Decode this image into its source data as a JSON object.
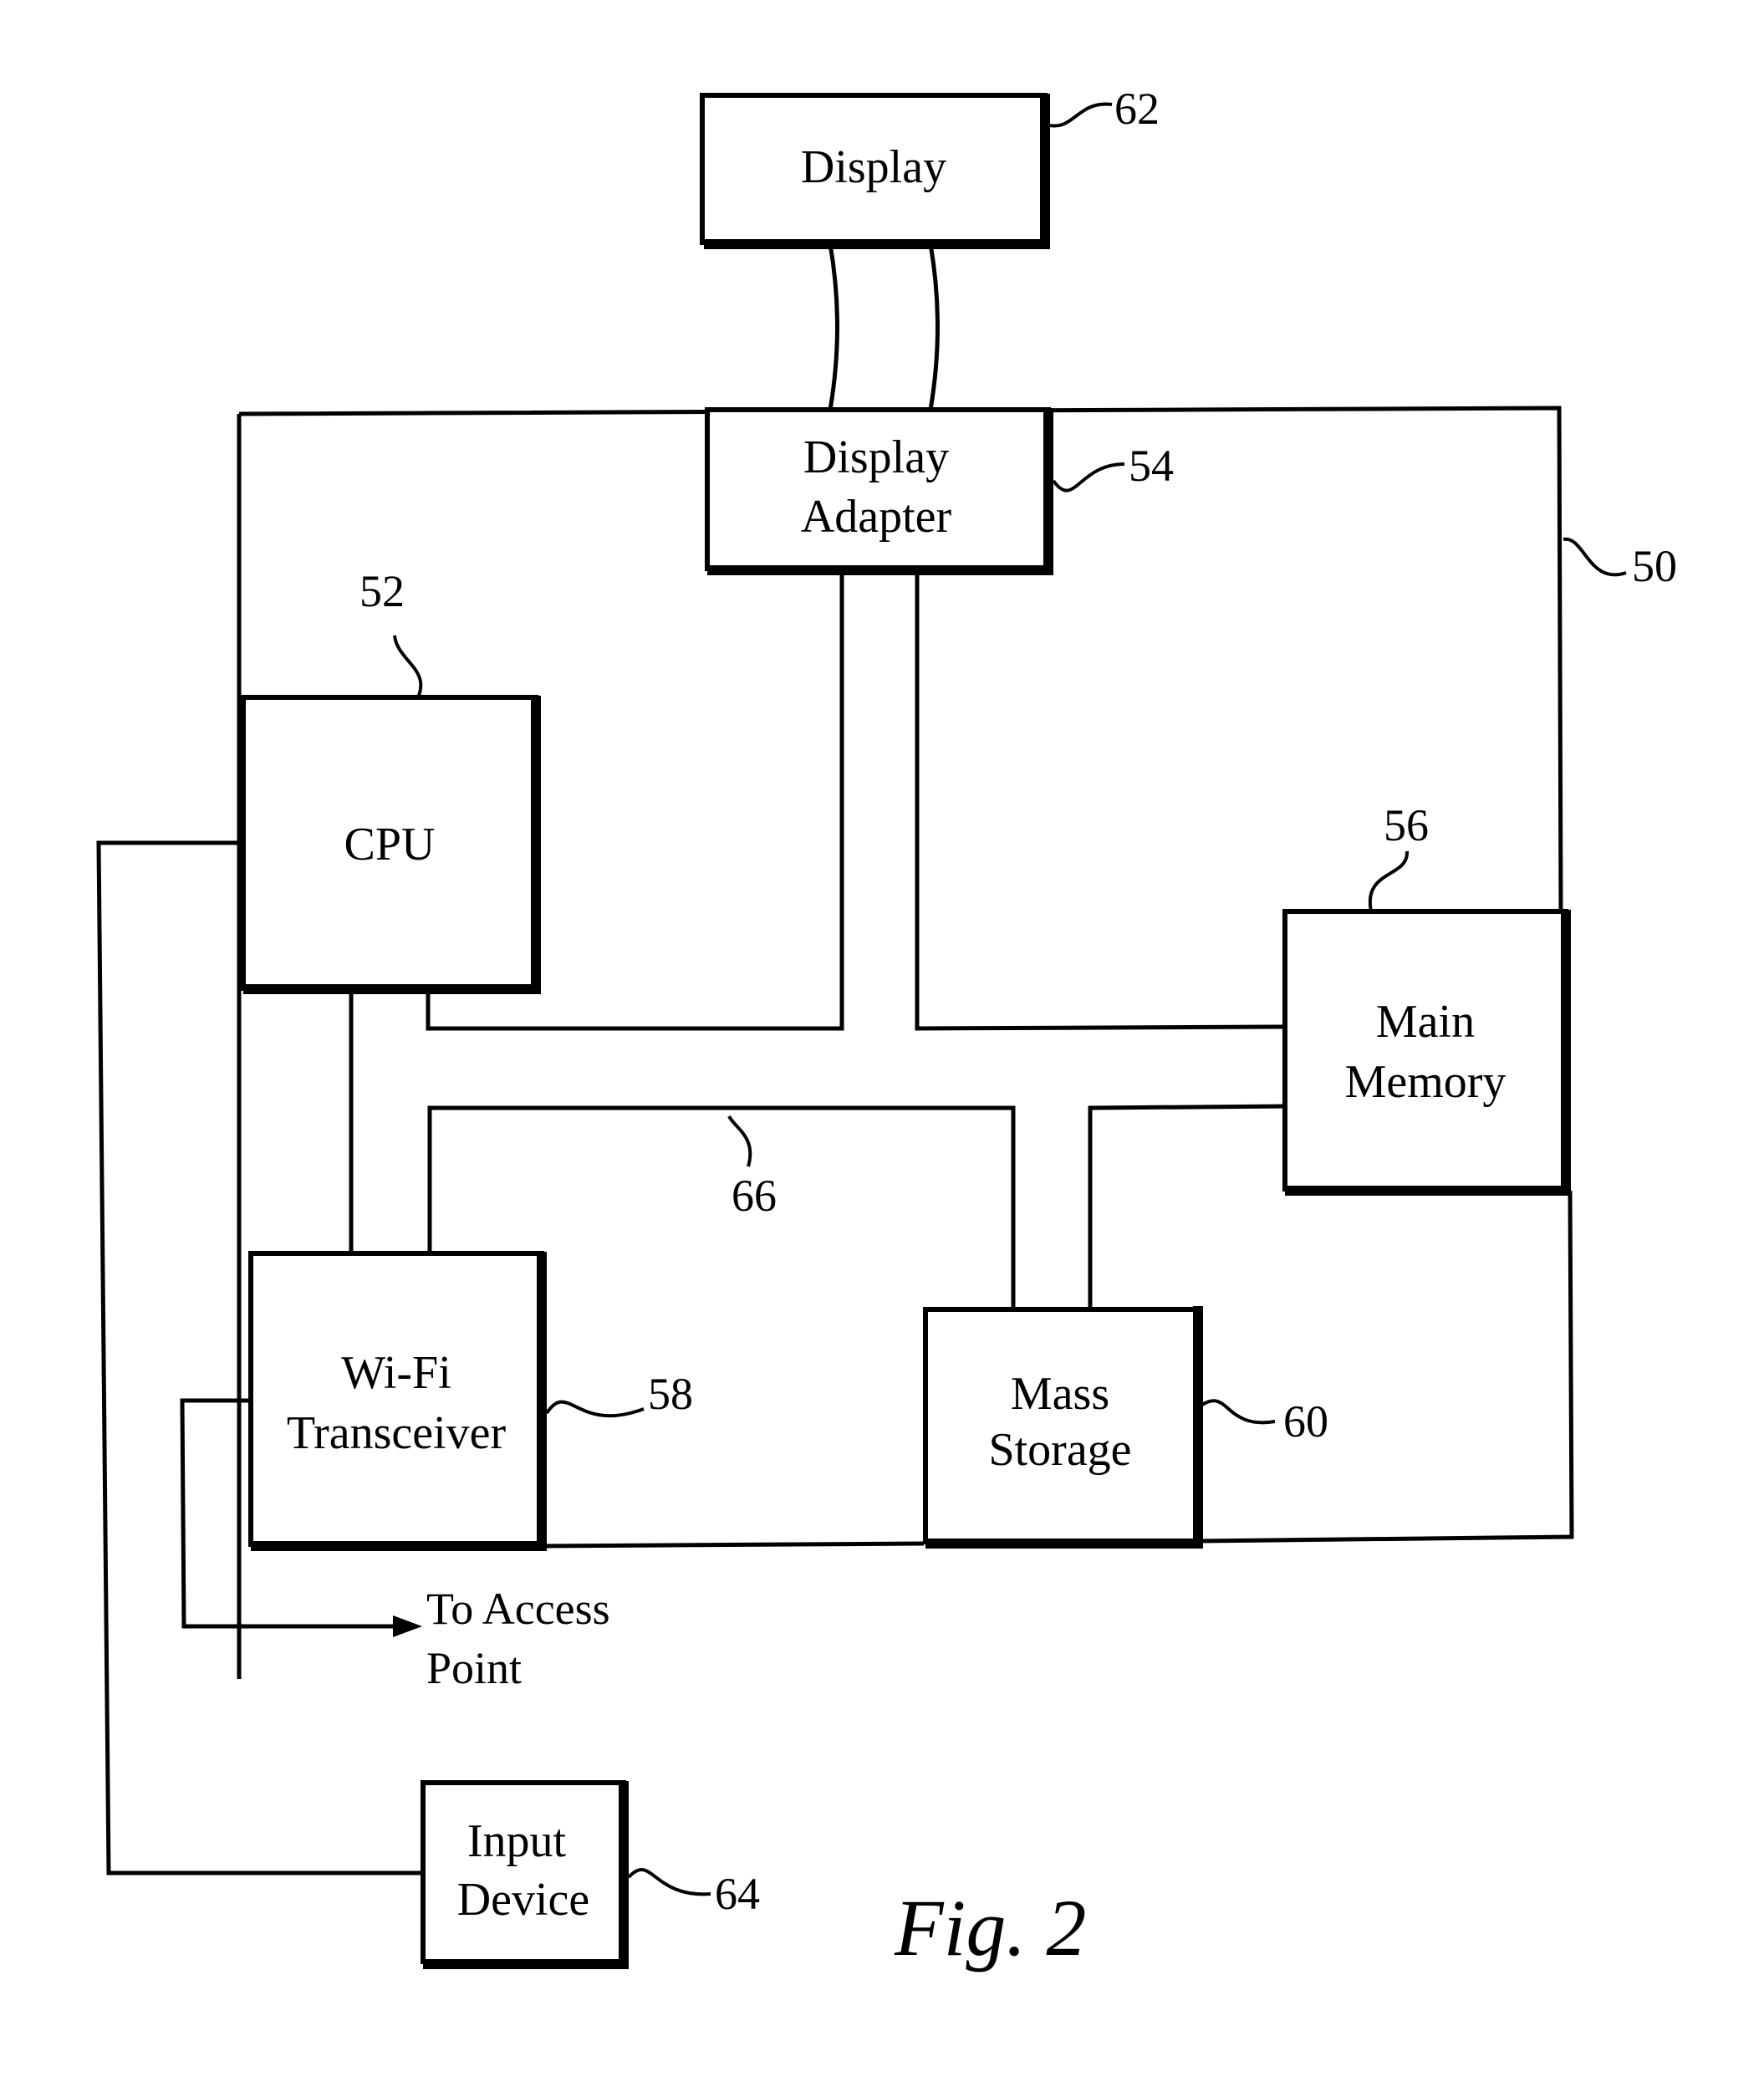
{
  "figure": {
    "caption": "Fig. 2",
    "system_ref": "50",
    "bus_ref": "66"
  },
  "blocks": {
    "display": {
      "label": [
        "Display"
      ],
      "ref": "62"
    },
    "display_adapter": {
      "label": [
        "Display",
        "Adapter"
      ],
      "ref": "54"
    },
    "cpu": {
      "label": [
        "CPU"
      ],
      "ref": "52"
    },
    "main_memory": {
      "label": [
        "Main",
        "Memory"
      ],
      "ref": "56"
    },
    "wifi_transceiver": {
      "label": [
        "Wi-Fi",
        "Transceiver"
      ],
      "ref": "58"
    },
    "mass_storage": {
      "label": [
        "Mass",
        "Storage"
      ],
      "ref": "60"
    },
    "input_device": {
      "label": [
        "Input",
        "Device"
      ],
      "ref": "64"
    }
  },
  "annotations": {
    "access_point": [
      "To Access",
      "Point"
    ]
  }
}
